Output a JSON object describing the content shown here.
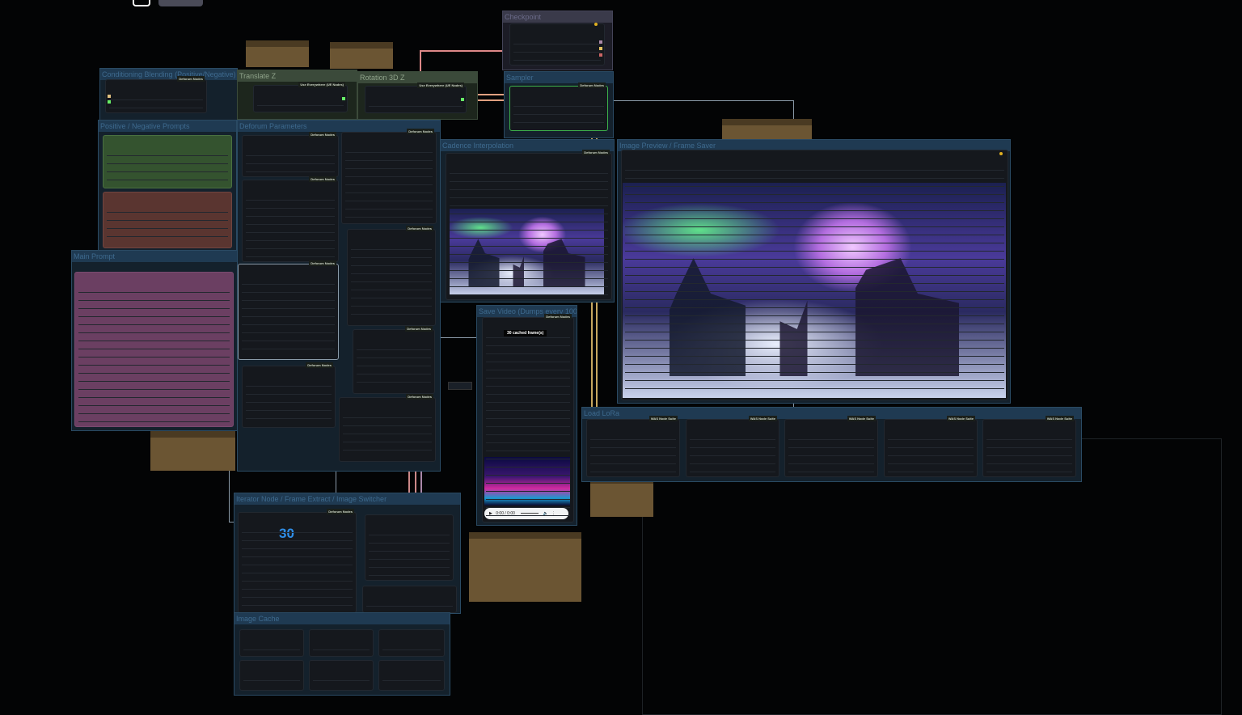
{
  "groups": {
    "checkpoint": "Checkpoint",
    "sampler": "Sampler",
    "conditioning": "Conditioning Blending (Positive/Negative)",
    "translate_z": "Translate Z",
    "rotation": "Rotation 3D Z",
    "prompts": "Positive / Negative Prompts",
    "deforum": "Deforum Parameters",
    "main_prompt": "Main Prompt",
    "cadence": "Cadence Interpolation",
    "preview": "Image Preview / Frame Saver",
    "save_video": "Save Video (Dumps every 100 frames)",
    "lora": "Load LoRa",
    "iterator": "Iterator Node / Frame Extract / Image Switcher",
    "cache": "Image Cache"
  },
  "badges": {
    "deforum": "Deforum Nodes",
    "use_everywhere": "Use Everywhere (UE Nodes)",
    "was": "WAS Node Suite"
  },
  "save_video": {
    "cached": "30 cached frame(s)",
    "time": "0:00 / 0:00"
  },
  "iterator": {
    "value": "30"
  },
  "colors": {
    "canvas": "#030405",
    "group": "#1f3a52",
    "note": "#6b5533",
    "link_green": "#6ee06e",
    "link_pink": "#e08080"
  }
}
